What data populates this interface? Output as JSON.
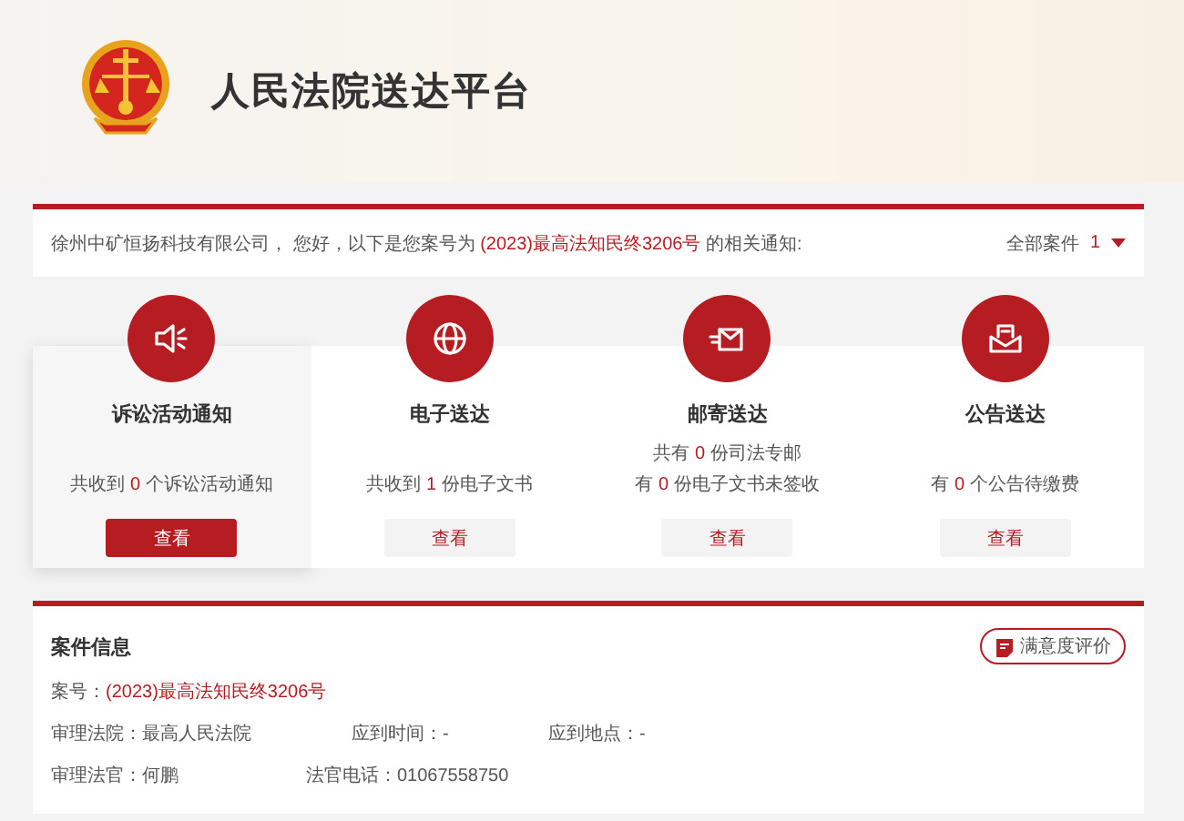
{
  "header": {
    "title": "人民法院送达平台"
  },
  "notice": {
    "before": "徐州中矿恒扬科技有限公司， 您好，以下是您案号为",
    "case_number": "(2023)最高法知民终3206号",
    "after": "的相关通知:",
    "filter_label": "全部案件",
    "filter_count": "1"
  },
  "cards": [
    {
      "kind": "notice",
      "title": "诉讼活动通知",
      "selected": true,
      "lines": [
        {
          "prefix": "共收到",
          "count": "0",
          "suffix": "个诉讼活动通知"
        }
      ],
      "button": "查看"
    },
    {
      "kind": "electronic",
      "title": "电子送达",
      "selected": false,
      "lines": [
        {
          "prefix": "共收到",
          "count": "1",
          "suffix": "份电子文书"
        }
      ],
      "button": "查看"
    },
    {
      "kind": "mail",
      "title": "邮寄送达",
      "selected": false,
      "lines": [
        {
          "prefix": "共有",
          "count": "0",
          "suffix": "份司法专邮"
        },
        {
          "prefix": "有",
          "count": "0",
          "suffix": "份电子文书未签收"
        }
      ],
      "button": "查看"
    },
    {
      "kind": "announcement",
      "title": "公告送达",
      "selected": false,
      "lines": [
        {
          "prefix": "有",
          "count": "0",
          "suffix": "个公告待缴费"
        }
      ],
      "button": "查看"
    }
  ],
  "case_info": {
    "title": "案件信息",
    "rating_button": "满意度评价",
    "case_number_label": "案号：",
    "case_number": "(2023)最高法知民终3206号",
    "rows": [
      [
        {
          "label": "审理法院：",
          "value": "最高人民法院"
        },
        {
          "label": "应到时间：",
          "value": "-"
        },
        {
          "label": "应到地点：",
          "value": "-"
        }
      ],
      [
        {
          "label": "审理法官：",
          "value": "何鹏"
        },
        {
          "label": "法官电话：",
          "value": "01067558750"
        }
      ]
    ]
  }
}
